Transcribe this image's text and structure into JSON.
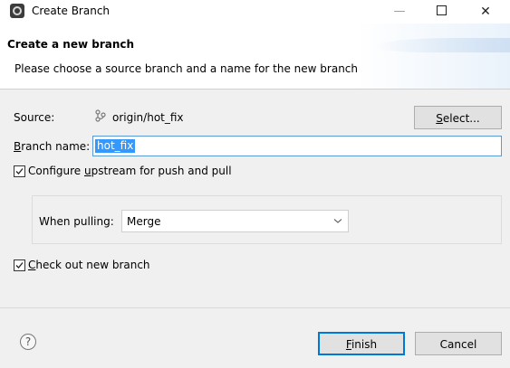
{
  "window": {
    "title": "Create Branch",
    "minimize_glyph": "—",
    "close_glyph": "✕"
  },
  "banner": {
    "title": "Create a new branch",
    "message": "Please choose a source branch and a name for the new branch"
  },
  "form": {
    "source_label": "Source:",
    "source_value": "origin/hot_fix",
    "select_button_prefix": "S",
    "select_button_rest": "elect...",
    "branch_name_label_first": "B",
    "branch_name_label_rest": "ranch name:",
    "branch_name_value": "hot_fix",
    "upstream_checked": true,
    "upstream_label_pre": "Configure ",
    "upstream_label_u": "u",
    "upstream_label_post": "pstream for push and pull",
    "when_pulling_label": "When pulling:",
    "when_pulling_value": "Merge",
    "checkout_checked": true,
    "checkout_label_first": "C",
    "checkout_label_rest": "heck out new branch"
  },
  "footer": {
    "help_glyph": "?",
    "finish_first": "F",
    "finish_rest": "inish",
    "cancel_label": "Cancel"
  },
  "colors": {
    "accent": "#0078d7",
    "selection": "#3399ff",
    "dialog_bg": "#f0f0f0"
  }
}
